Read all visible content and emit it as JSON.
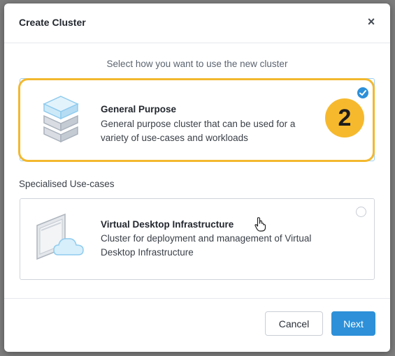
{
  "modal": {
    "title": "Create Cluster",
    "close_label": "×"
  },
  "instructions": "Select how you want to use the new cluster",
  "general_purpose": {
    "title": "General Purpose",
    "description": "General purpose cluster that can be used for a variety of use-cases and workloads",
    "selected": true
  },
  "step_badge": "2",
  "specialised": {
    "section_label": "Specialised Use-cases",
    "vdi": {
      "title": "Virtual Desktop Infrastructure",
      "description": "Cluster for deployment and management of Virtual Desktop Infrastructure",
      "selected": false
    }
  },
  "footer": {
    "cancel_label": "Cancel",
    "next_label": "Next"
  },
  "colors": {
    "accent": "#2d90d9",
    "highlight": "#f3b82e",
    "icon_blue": "#bfe3f7"
  },
  "icons": {
    "general": "server-stack-icon",
    "vdi": "desktop-cloud-icon",
    "check": "check-icon",
    "close": "close-icon",
    "cursor": "hand-pointer-icon"
  }
}
